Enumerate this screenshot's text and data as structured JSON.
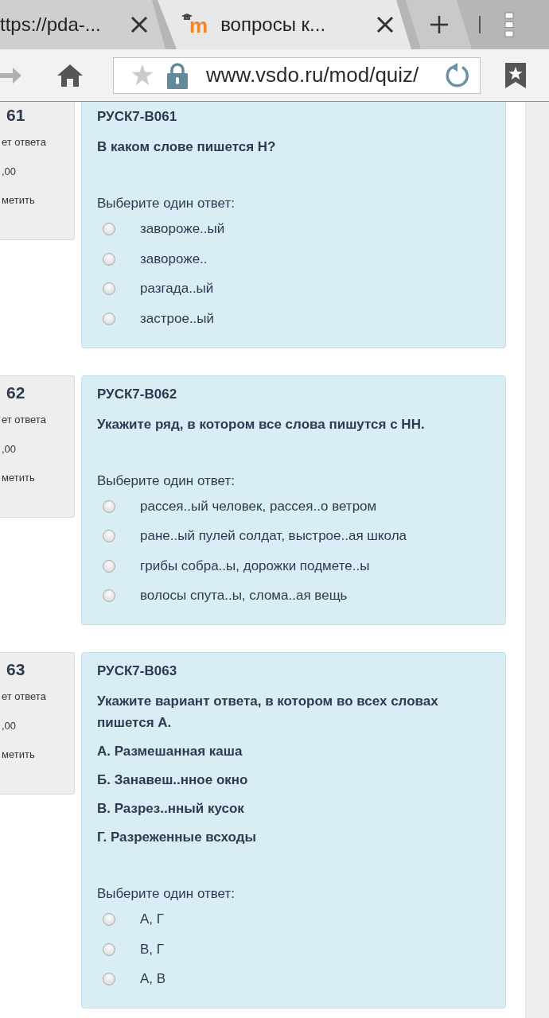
{
  "browser": {
    "tabs": [
      {
        "title": "ttps://pda-...",
        "selected": false
      },
      {
        "title": "вопросы к...",
        "favicon": "m",
        "selected": true
      }
    ],
    "address": "www.vsdo.ru/mod/quiz/"
  },
  "questions": [
    {
      "number": "61",
      "status": "ет ответа",
      "mark": ",00",
      "flag": "метить",
      "code": "РУСК7-В061",
      "text": "В каком слове пишется Н?",
      "prompt": "Выберите один ответ:",
      "options": [
        {
          "label": "завороже..ый",
          "selected": false
        },
        {
          "label": "завороже..",
          "selected": false
        },
        {
          "label": "разгада..ый",
          "selected": false
        },
        {
          "label": "застрое..ый",
          "selected": false
        }
      ]
    },
    {
      "number": "62",
      "status": "ет ответа",
      "mark": ",00",
      "flag": "метить",
      "code": "РУСК7-В062",
      "text": "Укажите ряд, в котором все слова пишутся с НН.",
      "prompt": "Выберите один ответ:",
      "options": [
        {
          "label": "рассея..ый человек, рассея..о ветром",
          "selected": false
        },
        {
          "label": "ране..ый пулей солдат, выстрое..ая школа",
          "selected": false
        },
        {
          "label": "грибы собра..ы, дорожки подмете..ы",
          "selected": false
        },
        {
          "label": "волосы спута..ы, слома..ая вещь",
          "selected": false
        }
      ]
    },
    {
      "number": "63",
      "status": "ет ответа",
      "mark": ",00",
      "flag": "метить",
      "code": "РУСК7-В063",
      "text": "Укажите вариант ответа, в котором во всех словах пишется А.",
      "details": [
        "А. Размешанная каша",
        "Б. Занавеш..нное окно",
        "В. Разрез..нный кусок",
        "Г. Разреженные всходы"
      ],
      "prompt": "Выберите один ответ:",
      "options": [
        {
          "label": "А, Г",
          "selected": false
        },
        {
          "label": "В, Г",
          "selected": false
        },
        {
          "label": "А, В",
          "selected": false
        }
      ]
    }
  ]
}
